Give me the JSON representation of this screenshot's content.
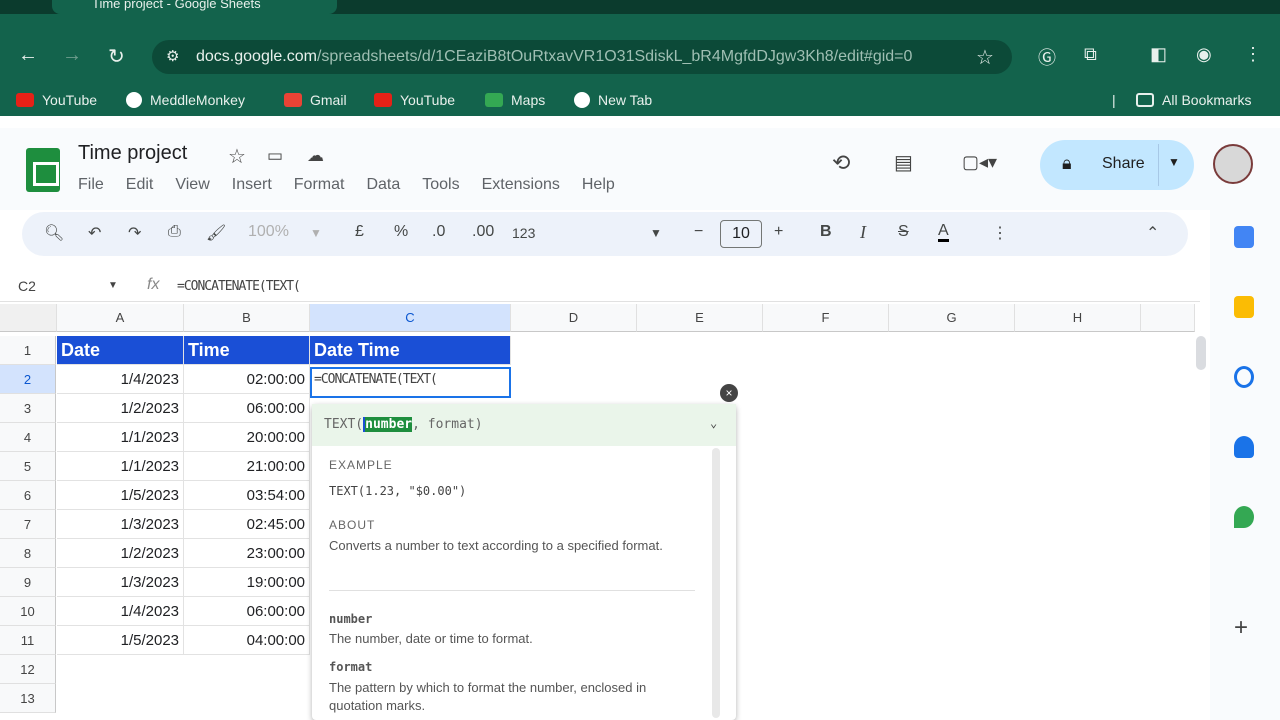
{
  "browser": {
    "tab_title": "Time project - Google Sheets",
    "url_main": "docs.google.com",
    "url_path": "/spreadsheets/d/1CEaziB8tOuRtxavVR1O31SdiskL_bR4MgfdDJgw3Kh8/edit#gid=0",
    "bookmarks": [
      "YouTube",
      "MeddleMonkey",
      "Gmail",
      "YouTube",
      "Maps",
      "New Tab"
    ],
    "all_bookmarks": "All Bookmarks"
  },
  "app": {
    "title": "Time project",
    "menus": [
      "File",
      "Edit",
      "View",
      "Insert",
      "Format",
      "Data",
      "Tools",
      "Extensions",
      "Help"
    ],
    "share_label": "Share"
  },
  "toolbar": {
    "zoom": "100%",
    "currency": "£",
    "percent": "%",
    "dec_decrease": ".0",
    "dec_increase": ".00",
    "format_123": "123",
    "font_size": "10",
    "bold": "B",
    "italic": "I",
    "strike": "S",
    "text_color": "A"
  },
  "formula_bar": {
    "name_box": "C2",
    "fx": "fx",
    "formula": "=CONCATENATE(TEXT("
  },
  "columns": [
    "A",
    "B",
    "C",
    "D",
    "E",
    "F",
    "G",
    "H"
  ],
  "rows": [
    "1",
    "2",
    "3",
    "4",
    "5",
    "6",
    "7",
    "8",
    "9",
    "10",
    "11",
    "12",
    "13"
  ],
  "headers": {
    "a": "Date",
    "b": "Time",
    "c": "Date Time"
  },
  "data_rows": [
    {
      "date": "1/4/2023",
      "time": "02:00:00"
    },
    {
      "date": "1/2/2023",
      "time": "06:00:00"
    },
    {
      "date": "1/1/2023",
      "time": "20:00:00"
    },
    {
      "date": "1/1/2023",
      "time": "21:00:00"
    },
    {
      "date": "1/5/2023",
      "time": "03:54:00"
    },
    {
      "date": "1/3/2023",
      "time": "02:45:00"
    },
    {
      "date": "1/2/2023",
      "time": "23:00:00"
    },
    {
      "date": "1/3/2023",
      "time": "19:00:00"
    },
    {
      "date": "1/4/2023",
      "time": "06:00:00"
    },
    {
      "date": "1/5/2023",
      "time": "04:00:00"
    }
  ],
  "active_cell_text": "=CONCATENATE(TEXT(",
  "popup": {
    "sig_fn": "TEXT(",
    "sig_arg1": "number",
    "sig_rest": ", format)",
    "example_label": "EXAMPLE",
    "example_code": "TEXT(1.23, \"$0.00\")",
    "about_label": "ABOUT",
    "about_text": "Converts a number to text according to a specified format.",
    "arg1_name": "number",
    "arg1_desc": "The number, date or time to format.",
    "arg2_name": "format",
    "arg2_desc": "The pattern by which to format the number, enclosed in quotation marks."
  }
}
